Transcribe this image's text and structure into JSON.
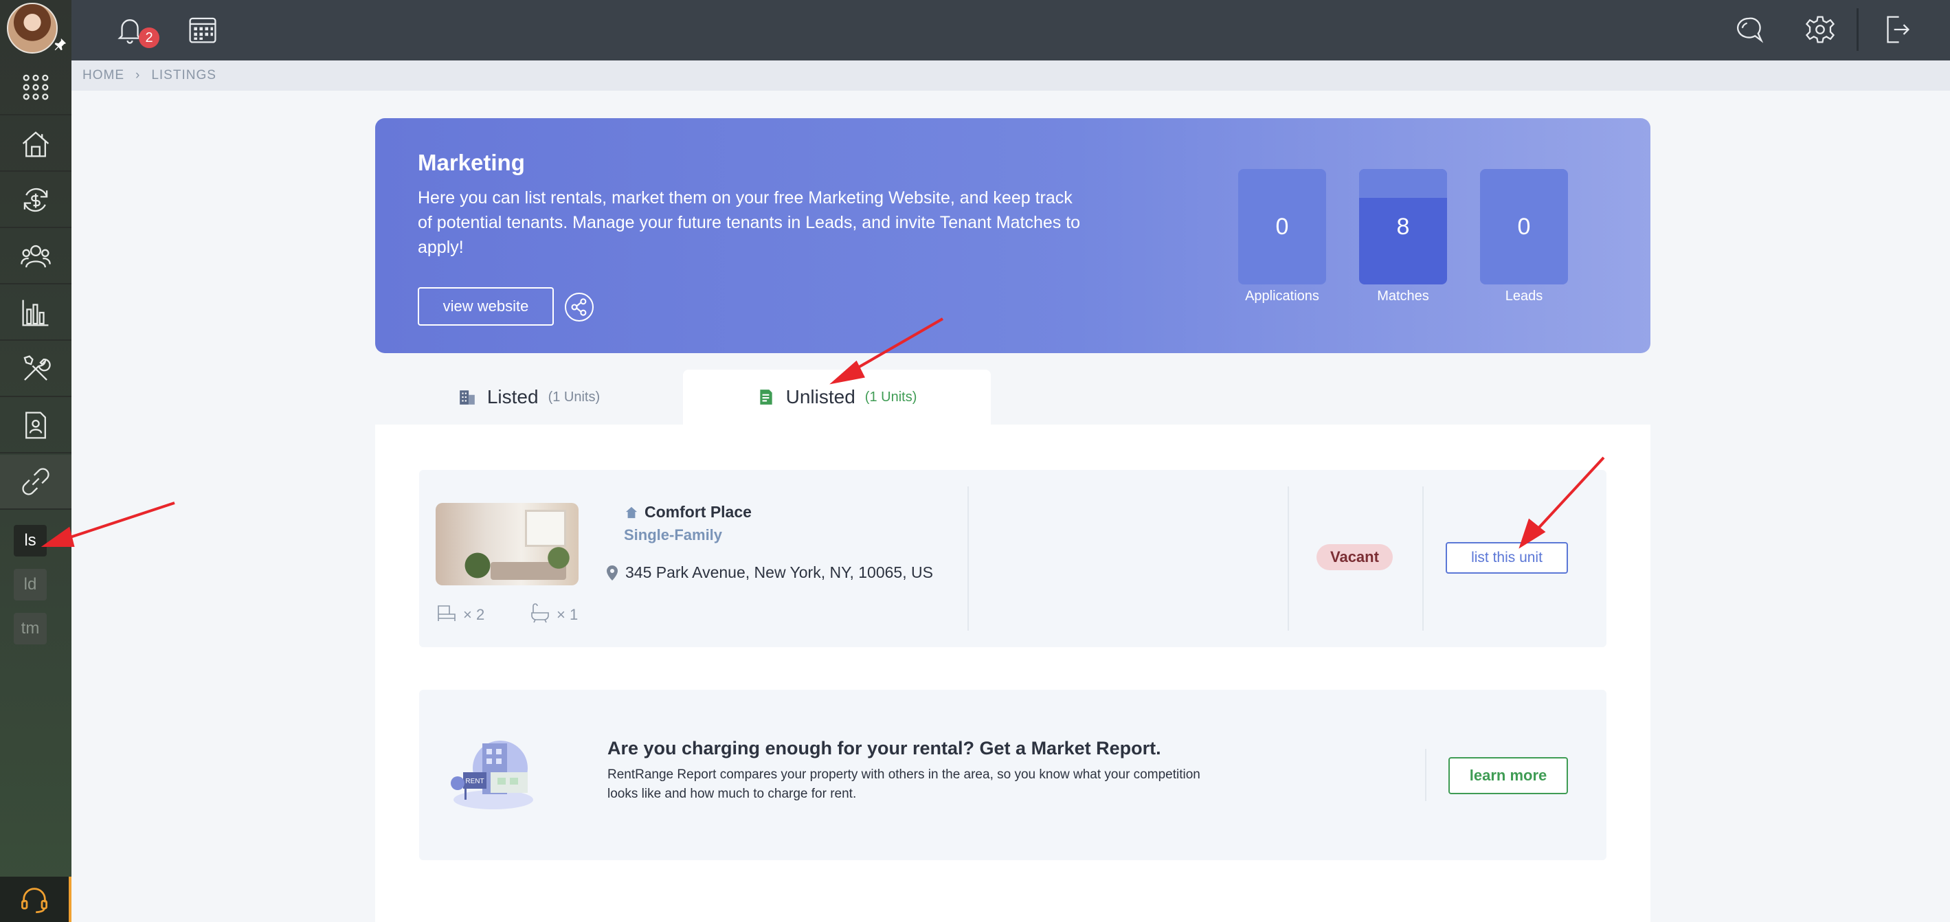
{
  "topbar": {
    "notification_count": "2"
  },
  "sidebar": {
    "items": [
      {
        "icon": "apps-grid-icon"
      },
      {
        "icon": "properties-icon"
      },
      {
        "icon": "accounting-icon"
      },
      {
        "icon": "people-icon"
      },
      {
        "icon": "reports-icon"
      },
      {
        "icon": "maintenance-icon"
      },
      {
        "icon": "documents-icon"
      },
      {
        "icon": "link-icon"
      }
    ],
    "mini_tabs": [
      "ls",
      "ld",
      "tm"
    ]
  },
  "breadcrumb": {
    "home": "HOME",
    "current": "LISTINGS"
  },
  "banner": {
    "title": "Marketing",
    "description": "Here you can list rentals, market them on your free Marketing Website, and keep track of potential tenants. Manage your future tenants in Leads, and invite Tenant Matches to apply!",
    "view_website_label": "view website",
    "stats": [
      {
        "value": "0",
        "label": "Applications"
      },
      {
        "value": "8",
        "label": "Matches"
      },
      {
        "value": "0",
        "label": "Leads"
      }
    ]
  },
  "tabs": {
    "listed": {
      "label": "Listed",
      "count": "(1 Units)"
    },
    "unlisted": {
      "label": "Unlisted",
      "count": "(1 Units)"
    }
  },
  "unit": {
    "name": "Comfort Place",
    "type": "Single-Family",
    "address": "345 Park Avenue, New York, NY, 10065, US",
    "beds": "× 2",
    "baths": "× 1",
    "status": "Vacant",
    "action_label": "list this unit"
  },
  "report": {
    "title": "Are you charging enough for your rental? Get a Market Report.",
    "description": "RentRange Report compares your property with others in the area, so you know what your competition looks like and how much to charge for rent.",
    "illustration_sign": "RENT",
    "button_label": "learn more"
  },
  "colors": {
    "accent": "#5b77d6",
    "success": "#3f9c54",
    "danger": "#e0494e",
    "annotation": "#e8262b"
  }
}
